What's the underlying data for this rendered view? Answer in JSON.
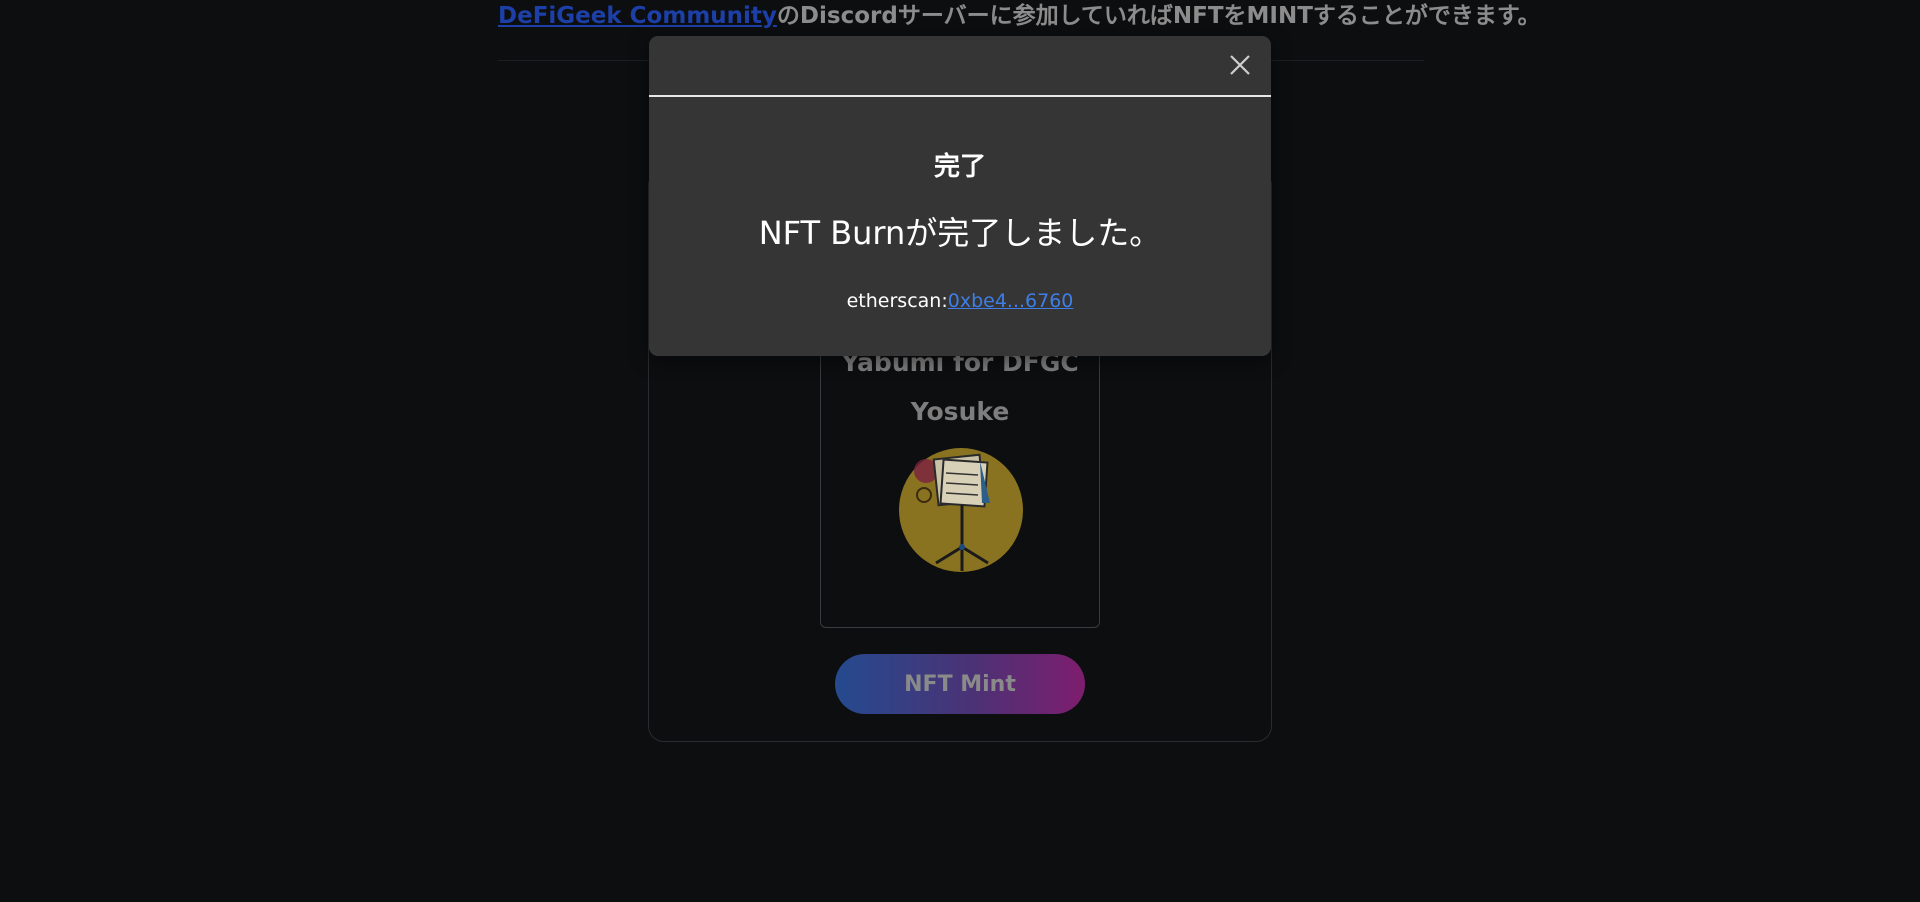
{
  "intro": {
    "link_text": "DeFiGeek Community",
    "text": "のDiscordサーバーに参加していればNFTをMINTすることができます。"
  },
  "colors": {
    "background": "#0d0e10",
    "modal_background": "#353535",
    "link": "#3f7ee6",
    "mint_gradient_start": "#254a8f",
    "mint_gradient_end": "#7e1d6e",
    "nft_image_background": "#8a7320"
  },
  "nft": {
    "title": "Yabumi for DFGC",
    "subtitle": "Yosuke",
    "image_icon": "music-stand-icon"
  },
  "mint_button": {
    "label": "NFT Mint"
  },
  "modal": {
    "close_icon": "close-icon",
    "title": "完了",
    "message": "NFT Burnが完了しました。",
    "tx_label": "etherscan:",
    "tx_link": "0xbe4...6760"
  }
}
